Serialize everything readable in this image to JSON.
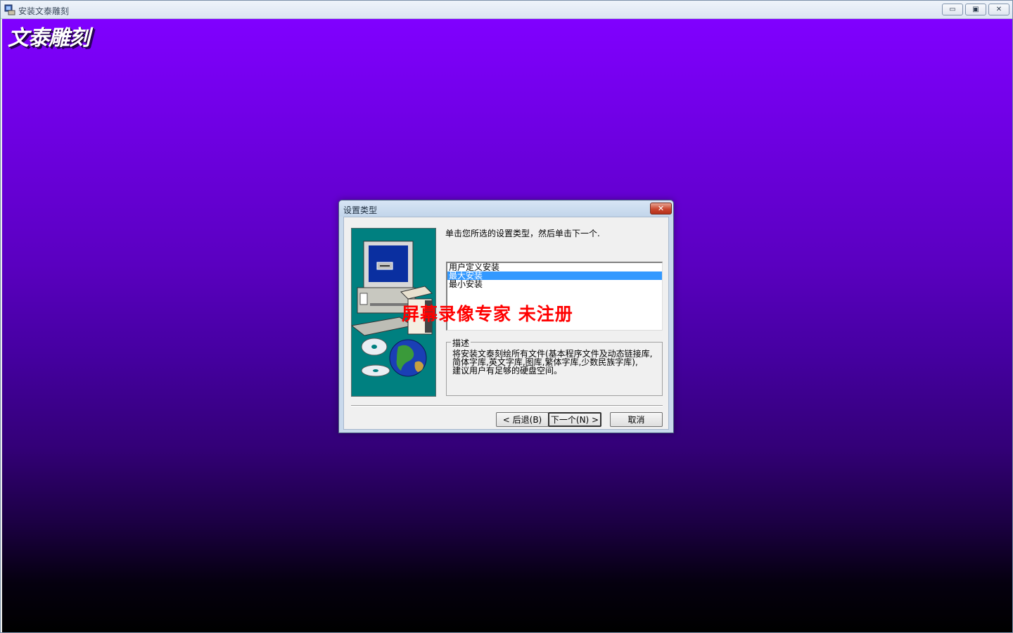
{
  "window": {
    "title": "安装文泰雕刻",
    "controls": {
      "minimize": "▭",
      "maximize": "▣",
      "close": "✕"
    }
  },
  "brand": {
    "title": "文泰雕刻"
  },
  "dialog": {
    "title": "设置类型",
    "close_label": "✕",
    "instruction": "单击您所选的设置类型，然后单击下一个.",
    "setup_types": [
      {
        "label": "用户定义安装",
        "selected": false
      },
      {
        "label": "最大安装",
        "selected": true
      },
      {
        "label": "最小安装",
        "selected": false
      }
    ],
    "description": {
      "legend": "描述",
      "lines": [
        "将安装文泰刻绘所有文件(基本程序文件及动态链接库,",
        "简体字库,英文字库,图库,繁体字库,少数民族字库),",
        "建议用户有足够的硬盘空间。"
      ]
    },
    "buttons": {
      "back": "< 后退(B)",
      "next": "下一个(N) >",
      "cancel": "取消"
    }
  },
  "watermark": "屏幕录像专家  未注册",
  "colors": {
    "gradient_top": "#8000ff",
    "gradient_bottom": "#000000",
    "selection": "#3399ff",
    "watermark": "#ff0000",
    "graphic_bg": "#008080"
  }
}
